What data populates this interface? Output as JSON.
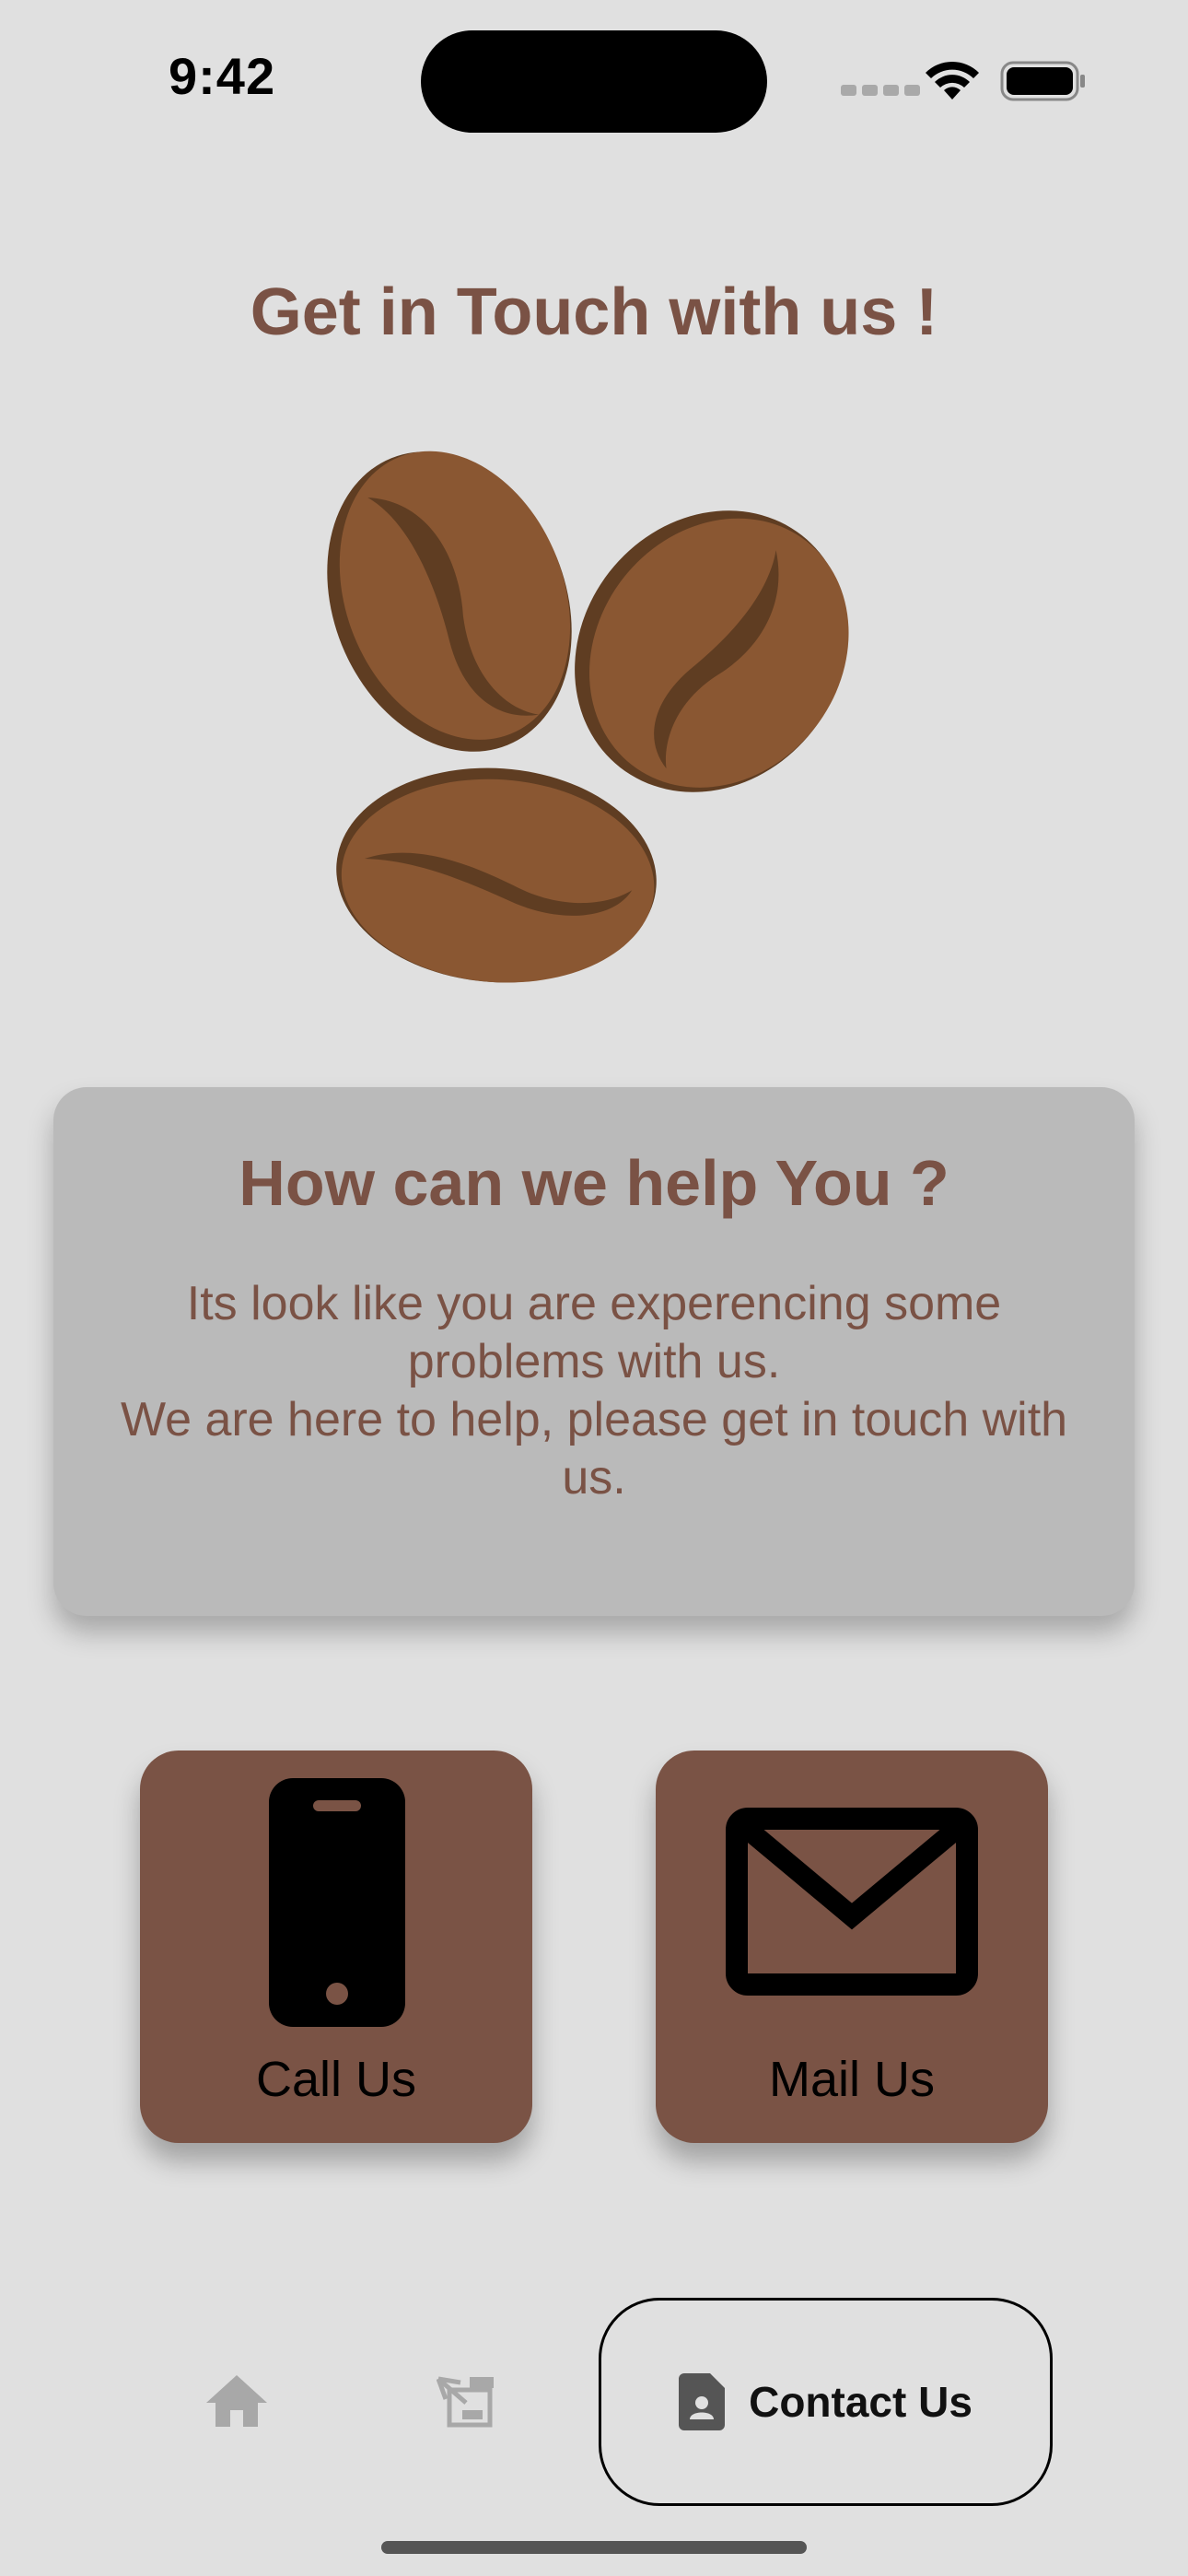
{
  "status_bar": {
    "time": "9:42"
  },
  "title": "Get in Touch with us !",
  "help_card": {
    "heading": "How can we help You ?",
    "message": "Its look like you are experencing some problems with us.\nWe are here to help, please get in touch with us."
  },
  "actions": {
    "call_label": "Call Us",
    "mail_label": "Mail Us"
  },
  "nav": {
    "active_label": "Contact Us",
    "items": [
      "home-icon",
      "coffee-menu-icon",
      "contact-icon"
    ]
  },
  "colors": {
    "background": "#e0e0e0",
    "accent_text": "#7a5245",
    "card": "#bababa",
    "button": "#7a5345",
    "bean_main": "#8a5732",
    "bean_dark": "#5f3d22"
  }
}
